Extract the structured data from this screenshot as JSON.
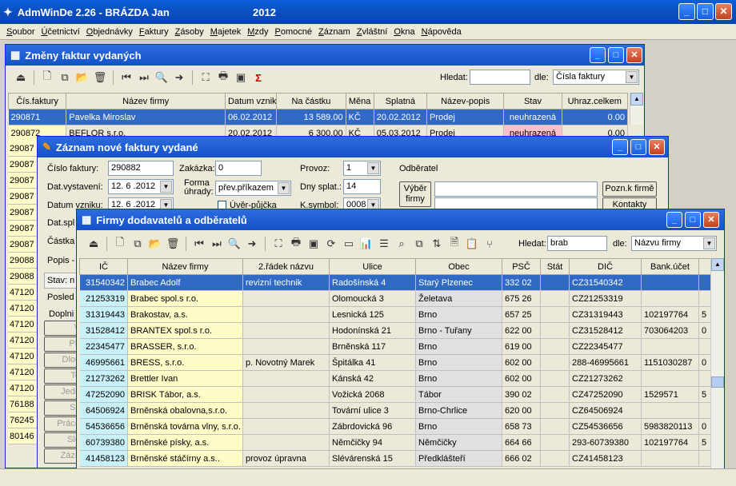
{
  "app": {
    "title": "AdmWinDe 2.26 - BRÁZDA Jan",
    "year": "2012"
  },
  "menu": [
    "Soubor",
    "Účetnictví",
    "Objednávky",
    "Faktury",
    "Zásoby",
    "Majetek",
    "Mzdy",
    "Pomocné",
    "Záznam",
    "Zvláštní",
    "Okna",
    "Nápověda"
  ],
  "win1": {
    "title": "Změny faktur vydaných",
    "search_label": "Hledat:",
    "search_value": "",
    "by_label": "dle:",
    "by_value": "Čísla faktury",
    "headers": [
      "Čís.faktury",
      "Název firmy",
      "Datum vzniku",
      "Na částku",
      "Měna",
      "Splatná",
      "Název-popis",
      "Stav",
      "Uhraz.celkem"
    ],
    "rows": [
      [
        "290871",
        "Pavelka Miroslav",
        "06.02.2012",
        "13 589.00",
        "KČ",
        "20.02.2012",
        "Prodej",
        "neuhrazená",
        "0.00"
      ],
      [
        "290872",
        "BEFLOR s.r.o.",
        "20.02.2012",
        "6 300.00",
        "KČ",
        "05.03.2012",
        "Prodej",
        "neuhrazená",
        "0.00"
      ]
    ],
    "left_values": [
      "29087",
      "29087",
      "29087",
      "29087",
      "29087",
      "29087",
      "29087",
      "29088",
      "29088",
      "47120",
      "47120",
      "47120",
      "47120",
      "47120",
      "47120",
      "47120",
      "76188",
      "76245",
      "80146"
    ]
  },
  "win2": {
    "title": "Záznam nové faktury vydané",
    "cislo_label": "Číslo faktury:",
    "cislo_value": "290882",
    "zakazka_label": "Zakázka:",
    "zakazka_value": "0",
    "provoz_label": "Provoz:",
    "provoz_value": "1",
    "odberatel_label": "Odběratel",
    "datvyst_label": "Dat.vystavení:",
    "datvyst_value": "12. 6 .2012",
    "forma_label": "Forma úhrady:",
    "forma_value": "přev.příkazem",
    "dnysplat_label": "Dny splat.:",
    "dnysplat_value": "14",
    "vyber_btn": "Výběr firmy",
    "pozn_btn": "Pozn.k firmě",
    "kontakty_btn": "Kontakty",
    "datvzn_label": "Datum vzniku:",
    "datvzn_value": "12. 6 .2012",
    "uverp_label": "Úvěr-půjčka",
    "ksymbol_label": "K.symbol:",
    "ksymbol_value": "0008",
    "datspl_label": "Dat.spl",
    "castka_label": "Částka",
    "popis_label": "Popis -",
    "stav_label": "Stav: n",
    "posled_label": "Posled",
    "dopln_label": "Doplni",
    "side_buttons": [
      "V",
      "Při",
      "Dlou",
      "Te",
      "Jedn",
      "Sk",
      "Práce",
      "Sle",
      "Zázn"
    ]
  },
  "win3": {
    "title": "Firmy dodavatelů a odběratelů",
    "search_label": "Hledat:",
    "search_value": "brab",
    "by_label": "dle:",
    "by_value": "Názvu firmy",
    "headers": [
      "IČ",
      "Název firmy",
      "2.řádek názvu",
      "Ulice",
      "Obec",
      "PSČ",
      "Stát",
      "DIČ",
      "Bank.účet",
      ""
    ],
    "rows": [
      [
        "31540342",
        "Brabec Adolf",
        "revizní technik",
        "Radošínská 4",
        "Starý Plzenec",
        "332 02",
        "",
        "CZ31540342",
        "",
        ""
      ],
      [
        "21253319",
        "Brabec spol.s r.o.",
        "",
        "Olomoucká 3",
        "Želetava",
        "675 26",
        "",
        "CZ21253319",
        "",
        ""
      ],
      [
        "31319443",
        "Brakostav, a.s.",
        "",
        "Lesnická 125",
        "Brno",
        "657 25",
        "",
        "CZ31319443",
        "102197764",
        "5"
      ],
      [
        "31528412",
        "BRANTEX spol.s r.o.",
        "",
        "Hodonínská 21",
        "Brno - Tuřany",
        "622 00",
        "",
        "CZ31528412",
        "703064203",
        "0"
      ],
      [
        "22345477",
        "BRASSER, s.r.o.",
        "",
        "Brněnská 117",
        "Brno",
        "619 00",
        "",
        "CZ22345477",
        "",
        ""
      ],
      [
        "46995661",
        "BRESS, s.r.o.",
        "p. Novotný Marek",
        "Špitálka 41",
        "Brno",
        "602 00",
        "",
        "288-46995661",
        "1151030287",
        "0"
      ],
      [
        "21273262",
        "Brettler Ivan",
        "",
        "Kánská 42",
        "Brno",
        "602 00",
        "",
        "CZ21273262",
        "",
        ""
      ],
      [
        "47252090",
        "BRISK Tábor, a.s.",
        "",
        "Vožická 2068",
        "Tábor",
        "390 02",
        "",
        "CZ47252090",
        "1529571",
        "5"
      ],
      [
        "64506924",
        "Brněnská obalovna,s.r.o.",
        "",
        "Tovární ulice 3",
        "Brno-Chrlice",
        "620 00",
        "",
        "CZ64506924",
        "",
        ""
      ],
      [
        "54536656",
        "Brněnská továrna vlny, s.r.o.",
        "",
        "Zábrdovická 96",
        "Brno",
        "658 73",
        "",
        "CZ54536656",
        "5983820113",
        "0"
      ],
      [
        "60739380",
        "Brněnské písky, a.s.",
        "",
        "Němčičky 94",
        "Němčičky",
        "664 66",
        "",
        "293-60739380",
        "102197764",
        "5"
      ],
      [
        "41458123",
        "Brněnské stáčírny a.s..",
        "provoz úpravna",
        "Slévárenská 15",
        "Předklášteří",
        "666 02",
        "",
        "CZ41458123",
        "",
        ""
      ]
    ]
  }
}
